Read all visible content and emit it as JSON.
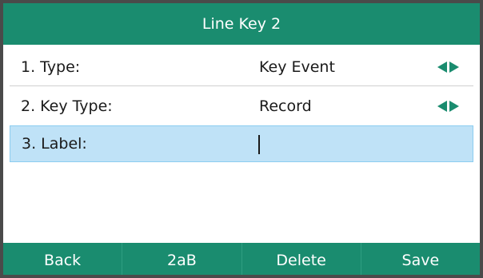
{
  "header": {
    "title": "Line Key 2"
  },
  "rows": [
    {
      "label": "1. Type:",
      "value": "Key Event",
      "has_arrows": true
    },
    {
      "label": "2. Key Type:",
      "value": "Record",
      "has_arrows": true
    },
    {
      "label": "3. Label:",
      "value": "",
      "selected": true
    }
  ],
  "softkeys": [
    "Back",
    "2aB",
    "Delete",
    "Save"
  ],
  "colors": {
    "accent": "#1a8c6f",
    "selected_row": "#bfe2f7",
    "frame": "#4a4a4a"
  },
  "icons": {
    "row_nav": [
      "left-arrow-icon",
      "right-arrow-icon"
    ]
  }
}
